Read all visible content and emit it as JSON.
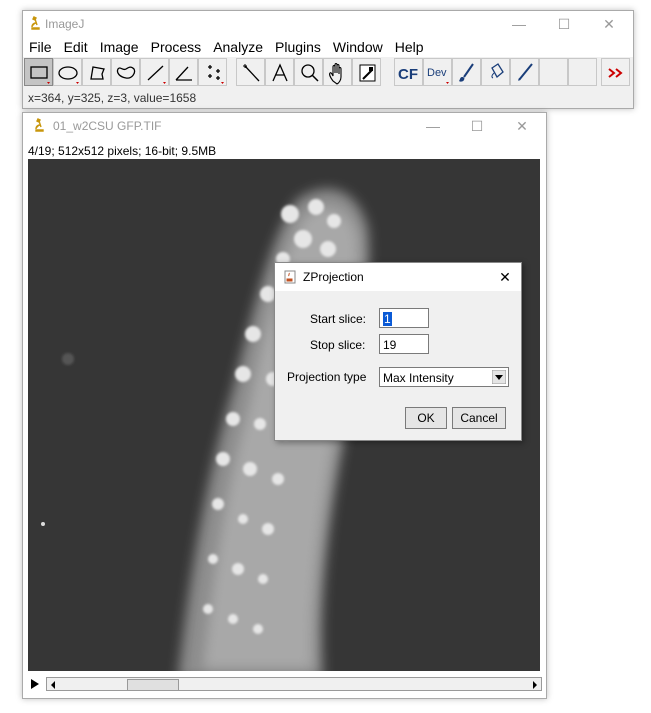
{
  "main_window": {
    "title": "ImageJ",
    "menu": [
      "File",
      "Edit",
      "Image",
      "Process",
      "Analyze",
      "Plugins",
      "Window",
      "Help"
    ],
    "tools": [
      "rectangle-tool",
      "oval-tool",
      "polygon-tool",
      "freehand-tool",
      "line-tool",
      "angle-tool",
      "point-tool",
      "wand-tool",
      "text-tool",
      "magnifier-tool",
      "hand-tool",
      "color-picker-tool",
      "cf-tool",
      "dev-tool",
      "brush-tool",
      "flood-fill-tool",
      "pencil-tool",
      "more-tools"
    ],
    "cf_label": "CF",
    "dev_label": "Dev",
    "status": "x=364, y=325, z=3, value=1658"
  },
  "image_window": {
    "title": "01_w2CSU GFP.TIF",
    "info": "4/19; 512x512 pixels; 16-bit; 9.5MB"
  },
  "dialog": {
    "title": "ZProjection",
    "start_label": "Start slice:",
    "start_value": "1",
    "stop_label": "Stop slice:",
    "stop_value": "19",
    "projection_label": "Projection type",
    "projection_value": "Max Intensity",
    "ok_label": "OK",
    "cancel_label": "Cancel"
  },
  "colors": {
    "selection": "#0a5ad6",
    "more_tools": "#cc0000"
  }
}
